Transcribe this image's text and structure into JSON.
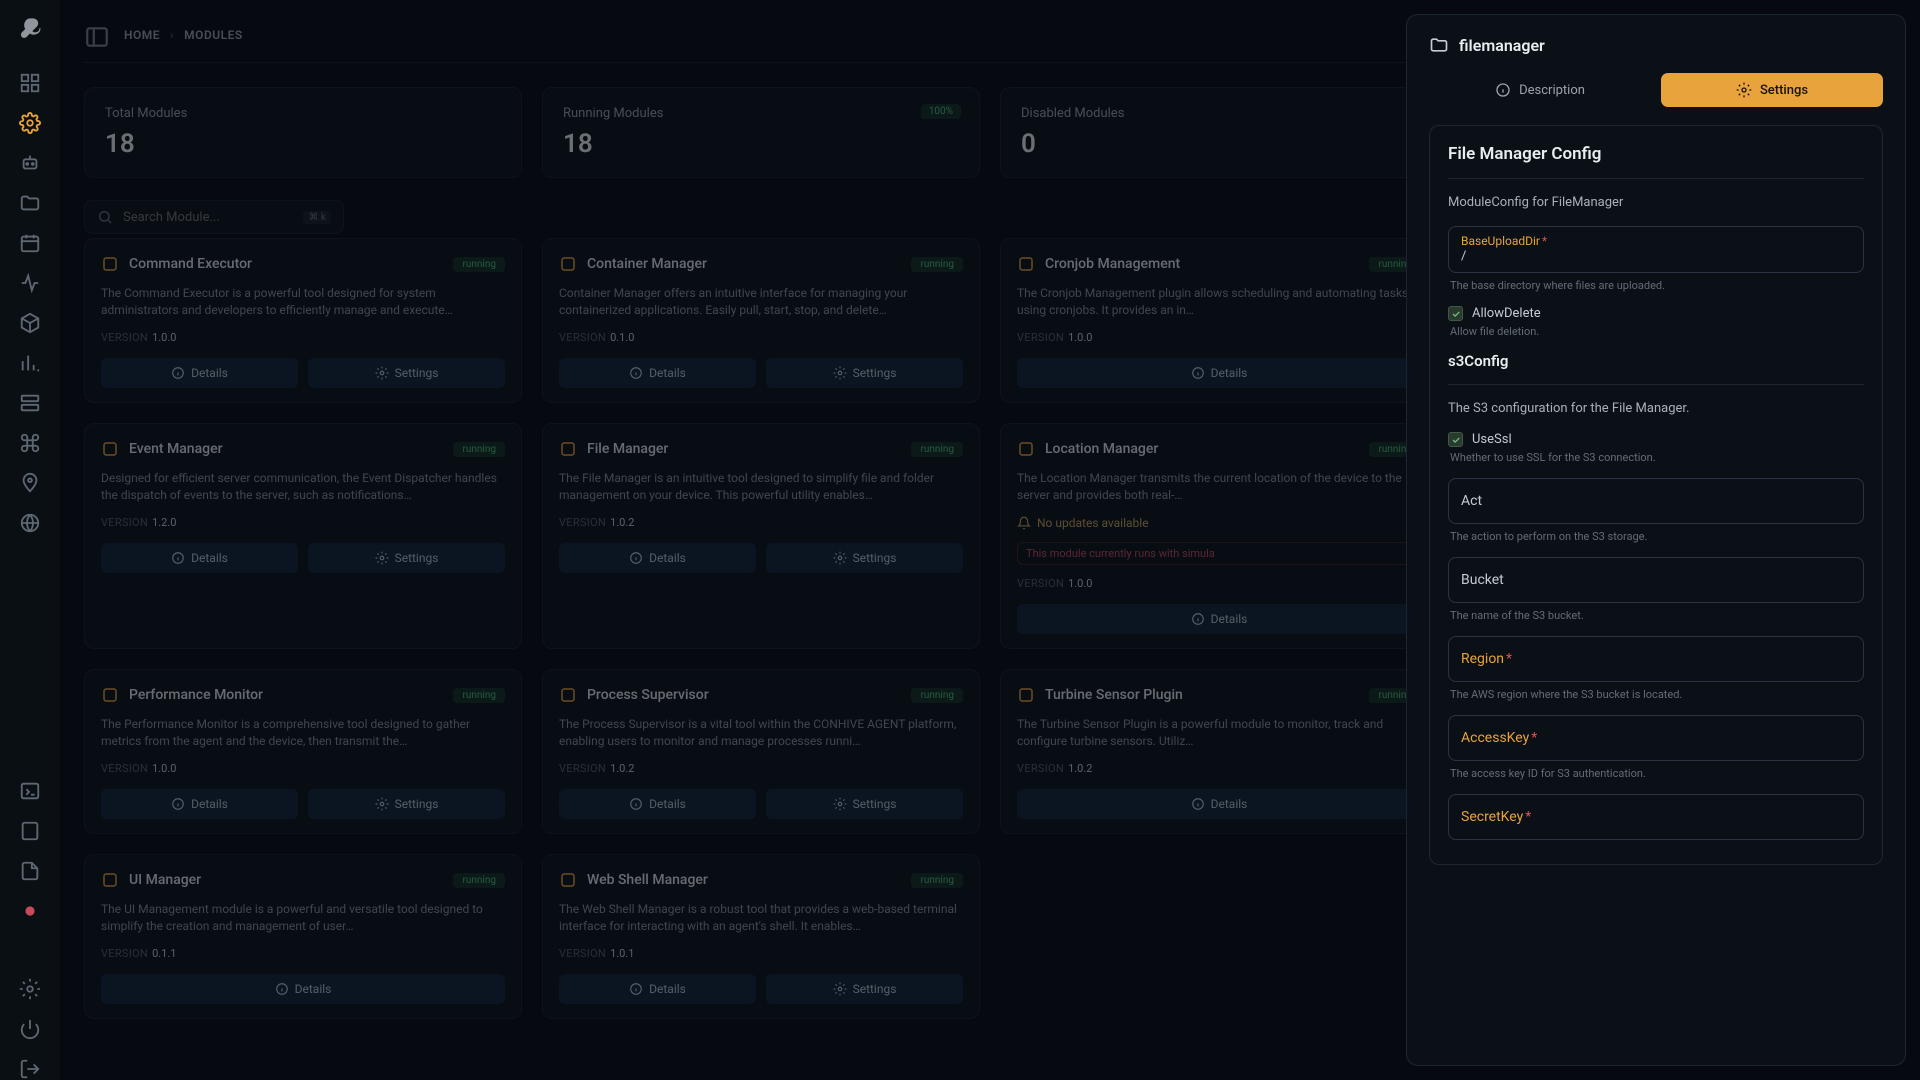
{
  "breadcrumb": [
    "HOME",
    "MODULES"
  ],
  "stats": [
    {
      "label": "Total Modules",
      "value": "18",
      "badge": null
    },
    {
      "label": "Running Modules",
      "value": "18",
      "badge": "100%"
    },
    {
      "label": "Disabled Modules",
      "value": "0",
      "badge": null
    },
    {
      "label": "",
      "value": "",
      "badge": null
    }
  ],
  "search": {
    "placeholder": "Search Module...",
    "kbd": "⌘ k"
  },
  "btn_labels": {
    "details": "Details",
    "settings": "Settings",
    "version": "VERSION"
  },
  "modules": [
    {
      "name": "Command Executor",
      "status": "running",
      "desc": "The Command Executor is a powerful tool designed for system administrators and developers to efficiently manage and execute…",
      "version": "1.0.0",
      "buttons": [
        "details",
        "settings"
      ]
    },
    {
      "name": "Container Manager",
      "status": "running",
      "desc": "Container Manager offers an intuitive interface for managing your containerized applications. Easily pull, start, stop, and delete…",
      "version": "0.1.0",
      "buttons": [
        "details",
        "settings"
      ]
    },
    {
      "name": "Cronjob Management",
      "status": "running",
      "desc": "The Cronjob Management plugin allows scheduling and automating tasks using cronjobs. It provides an in…",
      "version": "1.0.0",
      "buttons": [
        "details"
      ]
    },
    {
      "name": "",
      "status": "",
      "desc": "",
      "version": "",
      "buttons": []
    },
    {
      "name": "Event Manager",
      "status": "running",
      "desc": "Designed for efficient server communication, the Event Dispatcher handles the dispatch of events to the server, such as notifications…",
      "version": "1.2.0",
      "buttons": [
        "details",
        "settings"
      ]
    },
    {
      "name": "File Manager",
      "status": "running",
      "desc": "The File Manager is an intuitive tool designed to simplify file and folder management on your device. This powerful utility enables…",
      "version": "1.0.2",
      "buttons": [
        "details",
        "settings"
      ]
    },
    {
      "name": "Location Manager",
      "status": "running",
      "desc": "The Location Manager transmits the current location of the device to the server and provides both real-…",
      "version": "1.0.0",
      "buttons": [
        "details"
      ],
      "noupdate": "No updates available",
      "warning": "This module currently runs with simula"
    },
    {
      "name": "",
      "status": "",
      "desc": "",
      "version": "",
      "buttons": []
    },
    {
      "name": "Performance Monitor",
      "status": "running",
      "desc": "The Performance Monitor is a comprehensive tool designed to gather metrics from the agent and the device, then transmit the…",
      "version": "1.0.0",
      "buttons": [
        "details",
        "settings"
      ]
    },
    {
      "name": "Process Supervisor",
      "status": "running",
      "desc": "The Process Supervisor is a vital tool within the CONHIVE AGENT platform, enabling users to monitor and manage processes runni…",
      "version": "1.0.2",
      "buttons": [
        "details",
        "settings"
      ]
    },
    {
      "name": "Turbine Sensor Plugin",
      "status": "running",
      "desc": "The Turbine Sensor Plugin is a powerful module to monitor, track and configure turbine sensors. Utiliz…",
      "version": "1.0.2",
      "buttons": [
        "details"
      ]
    },
    {
      "name": "",
      "status": "",
      "desc": "",
      "version": "",
      "buttons": []
    },
    {
      "name": "UI Manager",
      "status": "running",
      "desc": "The UI Management module is a powerful and versatile tool designed to simplify the creation and management of user…",
      "version": "0.1.1",
      "buttons": [
        "details"
      ]
    },
    {
      "name": "Web Shell Manager",
      "status": "running",
      "desc": "The Web Shell Manager is a robust tool that provides a web-based terminal interface for interacting with an agent's shell. It enables…",
      "version": "1.0.1",
      "buttons": [
        "details",
        "settings"
      ]
    }
  ],
  "drawer": {
    "title": "filemanager",
    "tabs": {
      "description": "Description",
      "settings": "Settings"
    },
    "h2": "File Manager Config",
    "config_sub": "ModuleConfig for FileManager",
    "baseupload": {
      "label": "BaseUploadDir",
      "value": "/",
      "hint": "The base directory where files are uploaded."
    },
    "allowdelete": {
      "label": "AllowDelete",
      "hint": "Allow file deletion."
    },
    "s3": {
      "heading": "s3Config",
      "sub": "The S3 configuration for the File Manager.",
      "usessl": {
        "label": "UseSsl",
        "hint": "Whether to use SSL for the S3 connection."
      },
      "act": {
        "label": "Act",
        "hint": "The action to perform on the S3 storage."
      },
      "bucket": {
        "label": "Bucket",
        "hint": "The name of the S3 bucket."
      },
      "region": {
        "label": "Region",
        "hint": "The AWS region where the S3 bucket is located."
      },
      "accesskey": {
        "label": "AccessKey",
        "hint": "The access key ID for S3 authentication."
      },
      "secretkey": {
        "label": "SecretKey",
        "hint": ""
      }
    }
  }
}
